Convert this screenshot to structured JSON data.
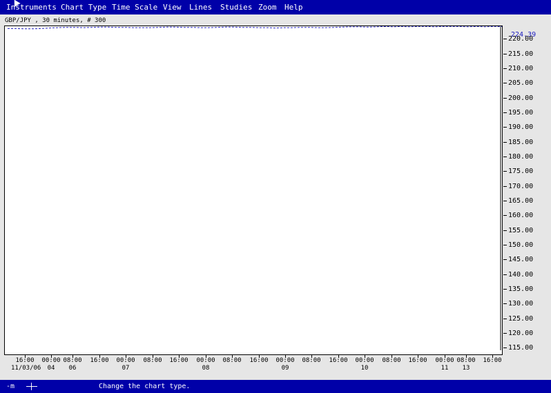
{
  "menubar": {
    "items": [
      "Instruments",
      "Chart Type",
      "Time Scale",
      "View",
      "Lines",
      "Studies",
      "Zoom",
      "Help"
    ]
  },
  "chart_title": "GBP/JPY , 30 minutes, # 300",
  "chart_data": {
    "type": "line",
    "title": "GBP/JPY , 30 minutes, # 300",
    "xlabel": "",
    "ylabel": "",
    "ylim": [
      112.5,
      224.5
    ],
    "yticks": [
      "220.00",
      "215.00",
      "210.00",
      "205.00",
      "200.00",
      "195.00",
      "190.00",
      "185.00",
      "180.00",
      "175.00",
      "170.00",
      "165.00",
      "160.00",
      "155.00",
      "150.00",
      "145.00",
      "140.00",
      "135.00",
      "130.00",
      "125.00",
      "120.00",
      "115.00"
    ],
    "last_price": "224.39",
    "x_time_labels": [
      "16:00",
      "00:00",
      "08:00",
      "16:00",
      "00:00",
      "08:00",
      "16:00",
      "00:00",
      "08:00",
      "16:00",
      "00:00",
      "08:00",
      "16:00",
      "00:00",
      "08:00",
      "16:00",
      "00:00",
      "08:00",
      "16:00"
    ],
    "x_date_labels": [
      "11/03/06",
      "04",
      "06",
      "07",
      "08",
      "09",
      "10",
      "11",
      "13"
    ],
    "series": [
      {
        "values": [
          223.7,
          223.7,
          223.6,
          223.6,
          223.7,
          223.9,
          224.0,
          224.1,
          224.1,
          224.0,
          224.1,
          224.2,
          224.2,
          224.1,
          224.1,
          224.0,
          224.0,
          224.0,
          224.1,
          224.2,
          224.2,
          224.1,
          224.1,
          224.0,
          224.0,
          224.1,
          224.2,
          224.2,
          224.1,
          224.1,
          224.0,
          224.0,
          223.9,
          224.0,
          224.0,
          224.1,
          224.1,
          224.0,
          224.0,
          224.1,
          224.2,
          224.3,
          224.3,
          224.2,
          224.3,
          224.4,
          224.3,
          224.4,
          224.3,
          224.4,
          224.4,
          224.3,
          224.4,
          224.4,
          224.4,
          224.3,
          224.4,
          224.3,
          224.4,
          224.39
        ]
      }
    ],
    "grid": false,
    "colors": {
      "line": "#2020c0",
      "last_price": "#2020c0"
    }
  },
  "statusbar": {
    "zoom_indicator": "-m",
    "message": "Change the chart type."
  }
}
